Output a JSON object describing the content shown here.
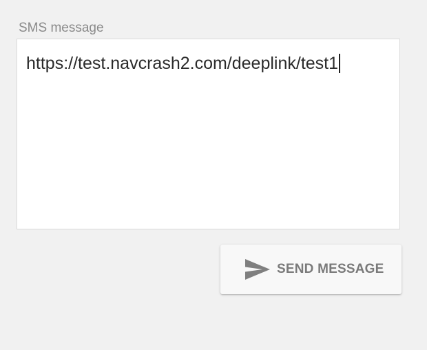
{
  "sms_field": {
    "label": "SMS message",
    "value": "https://test.navcrash2.com/deeplink/test1"
  },
  "send_button": {
    "label": "SEND MESSAGE",
    "icon": "send-icon"
  },
  "colors": {
    "background": "#f1f1f1",
    "label_text": "#8a8a8a",
    "button_text": "#7a7a7a",
    "icon": "#7f7f7f"
  }
}
